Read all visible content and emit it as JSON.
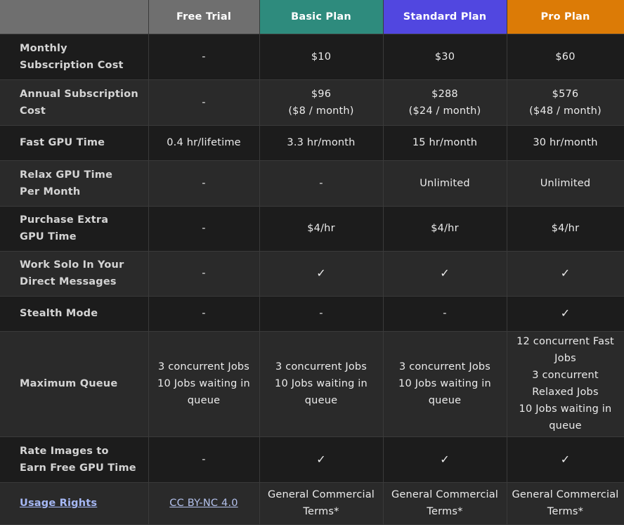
{
  "header": {
    "blank": "",
    "plans": [
      {
        "name": "Free Trial",
        "color": "#6f6f6f"
      },
      {
        "name": "Basic Plan",
        "color": "#2e8b7d"
      },
      {
        "name": "Standard Plan",
        "color": "#5147e0"
      },
      {
        "name": "Pro Plan",
        "color": "#dc7b06"
      }
    ]
  },
  "rows": [
    {
      "label": [
        "Monthly",
        "Subscription Cost"
      ],
      "cells": [
        [
          "-"
        ],
        [
          "$10"
        ],
        [
          "$30"
        ],
        [
          "$60"
        ]
      ]
    },
    {
      "label": [
        "Annual Subscription",
        "Cost"
      ],
      "cells": [
        [
          "-"
        ],
        [
          "$96",
          "($8 / month)"
        ],
        [
          "$288",
          "($24 / month)"
        ],
        [
          "$576",
          "($48 / month)"
        ]
      ]
    },
    {
      "label": [
        "Fast GPU Time"
      ],
      "cells": [
        [
          "0.4 hr/lifetime"
        ],
        [
          "3.3 hr/month"
        ],
        [
          "15 hr/month"
        ],
        [
          "30 hr/month"
        ]
      ]
    },
    {
      "label": [
        "Relax GPU Time",
        "Per Month"
      ],
      "cells": [
        [
          "-"
        ],
        [
          "-"
        ],
        [
          "Unlimited"
        ],
        [
          "Unlimited"
        ]
      ]
    },
    {
      "label": [
        "Purchase Extra",
        "GPU Time"
      ],
      "cells": [
        [
          "-"
        ],
        [
          "$4/hr"
        ],
        [
          "$4/hr"
        ],
        [
          "$4/hr"
        ]
      ]
    },
    {
      "label": [
        "Work Solo In Your",
        "Direct Messages"
      ],
      "cells": [
        [
          "-"
        ],
        [
          "✓"
        ],
        [
          "✓"
        ],
        [
          "✓"
        ]
      ]
    },
    {
      "label": [
        "Stealth Mode"
      ],
      "cells": [
        [
          "-"
        ],
        [
          "-"
        ],
        [
          "-"
        ],
        [
          "✓"
        ]
      ]
    },
    {
      "label": [
        "Maximum Queue"
      ],
      "cells": [
        [
          "3 concurrent Jobs",
          "10 Jobs waiting in",
          "queue"
        ],
        [
          "3 concurrent Jobs",
          "10 Jobs waiting in",
          "queue"
        ],
        [
          "3 concurrent Jobs",
          "10 Jobs waiting in",
          "queue"
        ],
        [
          "12 concurrent Fast",
          "Jobs",
          "3 concurrent",
          "Relaxed Jobs",
          "10 Jobs waiting in",
          "queue"
        ]
      ]
    },
    {
      "label": [
        "Rate Images to",
        "Earn Free GPU Time"
      ],
      "cells": [
        [
          "-"
        ],
        [
          "✓"
        ],
        [
          "✓"
        ],
        [
          "✓"
        ]
      ]
    },
    {
      "label": [
        "Usage Rights"
      ],
      "cells": [
        [
          "CC BY-NC 4.0"
        ],
        [
          "General Commercial",
          "Terms*"
        ],
        [
          "General Commercial",
          "Terms*"
        ],
        [
          "General Commercial",
          "Terms*"
        ]
      ]
    }
  ]
}
